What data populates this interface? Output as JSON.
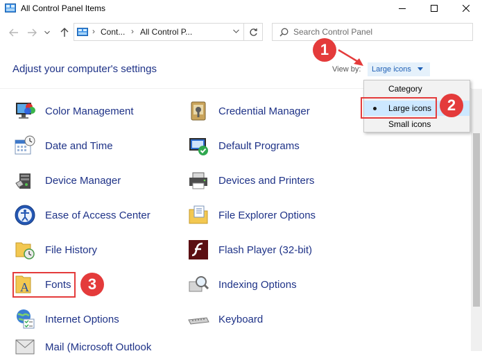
{
  "window": {
    "title": "All Control Panel Items",
    "minimize_icon": "minimize-icon",
    "maximize_icon": "maximize-icon",
    "close_icon": "close-icon"
  },
  "address_bar": {
    "crumbs": [
      "Cont...",
      "All Control P..."
    ],
    "search_placeholder": "Search Control Panel"
  },
  "header": {
    "title": "Adjust your computer's settings",
    "view_by_label": "View by:",
    "view_by_value": "Large icons"
  },
  "view_menu": {
    "options": [
      "Category",
      "Large icons",
      "Small icons"
    ],
    "selected": "Large icons"
  },
  "items": [
    {
      "label": "Color Management",
      "icon": "color-management-icon"
    },
    {
      "label": "Credential Manager",
      "icon": "credential-manager-icon"
    },
    {
      "label": "Date and Time",
      "icon": "date-time-icon"
    },
    {
      "label": "Default Programs",
      "icon": "default-programs-icon"
    },
    {
      "label": "Device Manager",
      "icon": "device-manager-icon"
    },
    {
      "label": "Devices and Printers",
      "icon": "devices-printers-icon"
    },
    {
      "label": "Ease of Access Center",
      "icon": "ease-of-access-icon"
    },
    {
      "label": "File Explorer Options",
      "icon": "file-explorer-options-icon"
    },
    {
      "label": "File History",
      "icon": "file-history-icon"
    },
    {
      "label": "Flash Player (32-bit)",
      "icon": "flash-player-icon"
    },
    {
      "label": "Fonts",
      "icon": "fonts-icon"
    },
    {
      "label": "Indexing Options",
      "icon": "indexing-options-icon"
    },
    {
      "label": "Internet Options",
      "icon": "internet-options-icon"
    },
    {
      "label": "Keyboard",
      "icon": "keyboard-icon"
    },
    {
      "label": "Mail (Microsoft Outlook",
      "icon": "mail-icon"
    }
  ],
  "annotations": {
    "step1": "1",
    "step2": "2",
    "step3": "3",
    "color": "#e43b3b"
  },
  "colors": {
    "link": "#1e3287",
    "menu_highlight": "#cde8ff",
    "viewby_bg": "#e5f1fb"
  }
}
